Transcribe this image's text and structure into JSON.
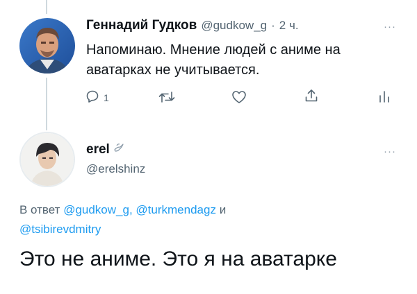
{
  "tweet1": {
    "author_name": "Геннадий Гудков",
    "handle": "@gudkow_g",
    "separator": "·",
    "time": "2 ч.",
    "more_label": "···",
    "text": "Напоминаю. Мнение людей с аниме на аватарках не учитывается.",
    "actions": {
      "reply_count": "1"
    }
  },
  "tweet2": {
    "author_name": "erel",
    "handle": "@erelshinz",
    "more_label": "···",
    "reply_prefix": "В ответ",
    "mention_1": "@gudkow_g,",
    "mention_2": "@turkmendagz",
    "reply_and": "и",
    "mention_3": "@tsibirevdmitry",
    "text": "Это не аниме. Это я на аватарке"
  },
  "icons": {
    "reply": "reply-icon",
    "retweet": "retweet-icon",
    "like": "heart-icon",
    "share": "share-icon",
    "analytics": "analytics-icon",
    "badge": "dove-icon"
  },
  "colors": {
    "link": "#1d9bf0",
    "muted": "#536471",
    "thread_line": "#cfd9de",
    "text": "#0f1419"
  }
}
